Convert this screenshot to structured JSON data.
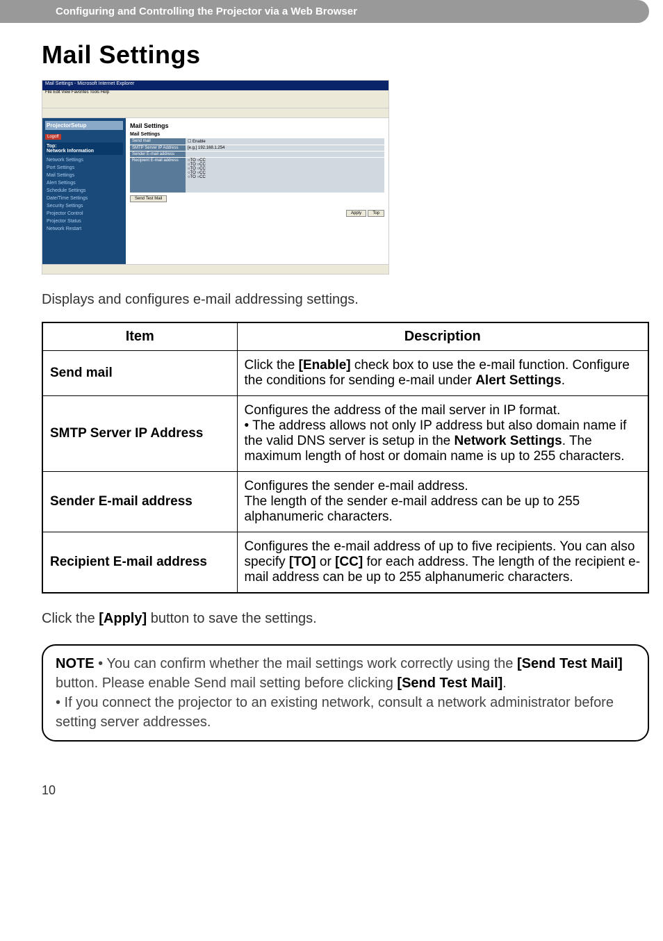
{
  "header": {
    "breadcrumb": "Configuring and Controlling the Projector via a Web Browser"
  },
  "title": "Mail Settings",
  "screenshot": {
    "window_title": "Mail Settings - Microsoft Internet Explorer",
    "menubar": "File  Edit  View  Favorites  Tools  Help",
    "sidebar_header": "ProjectorSetup",
    "logoff": "Logoff",
    "nav_top": "Top:",
    "nav_section": "Network Information",
    "nav_items": [
      "Network Settings",
      "Port Settings",
      "Mail Settings",
      "Alert Settings",
      "Schedule Settings",
      "Date/Time Settings",
      "Security Settings",
      "Projector Control",
      "Projector Status",
      "Network Restart"
    ],
    "content_title": "Mail Settings",
    "content_subtitle": "Mail Settings",
    "rows": {
      "send_mail": "Send mail",
      "enable": "Enable",
      "smtp_label": "SMTP Server IP Address",
      "smtp_example": "[e.g.] 192.168.1.254",
      "sender_label": "Sender E-mail address",
      "recipient_label": "Recipient E-mail address",
      "to": "TO",
      "cc": "CC"
    },
    "send_test_btn": "Send Test Mail",
    "apply_btn": "Apply",
    "top_btn": "Top"
  },
  "intro": "Displays and configures e-mail addressing settings.",
  "table": {
    "header_item": "Item",
    "header_desc": "Description",
    "rows": [
      {
        "item": "Send mail",
        "desc_pre": "Click the ",
        "desc_bold1": "[Enable]",
        "desc_mid": " check box to use the e-mail function. Configure the conditions for sending e-mail under ",
        "desc_bold2": "Alert Settings",
        "desc_post": "."
      },
      {
        "item": "SMTP Server IP Address",
        "desc_line1": "Configures the address of the mail server in IP format.",
        "desc_line2_pre": "• The address allows not only IP address but also domain name if the valid DNS server is setup in the ",
        "desc_line2_bold": "Network Settings",
        "desc_line2_post": ". The maximum length of host or domain name is up to 255 characters."
      },
      {
        "item": "Sender E-mail address",
        "desc_line1": "Configures the sender e-mail address.",
        "desc_line2": "The length of the sender e-mail address can be up to 255 alphanumeric characters."
      },
      {
        "item": "Recipient E-mail address",
        "desc_pre": "Configures the e-mail address of up to five recipients. You can also specify ",
        "desc_bold1": "[TO]",
        "desc_mid": " or ",
        "desc_bold2": "[CC]",
        "desc_post": " for each address. The length of the recipient e-mail address can be up to 255 alphanumeric characters."
      }
    ]
  },
  "apply_text_pre": "Click the ",
  "apply_text_bold": "[Apply]",
  "apply_text_post": " button to save the settings.",
  "note": {
    "label": "NOTE",
    "text1_pre": "  • You can confirm whether the mail settings work correctly using the ",
    "text1_bold1": "[Send Test Mail]",
    "text1_mid": " button. Please enable Send mail setting before clicking ",
    "text1_bold2": "[Send Test Mail]",
    "text1_post": ".",
    "text2": "• If you connect the projector to an existing network, consult a network administrator before setting server addresses."
  },
  "page_number": "10"
}
